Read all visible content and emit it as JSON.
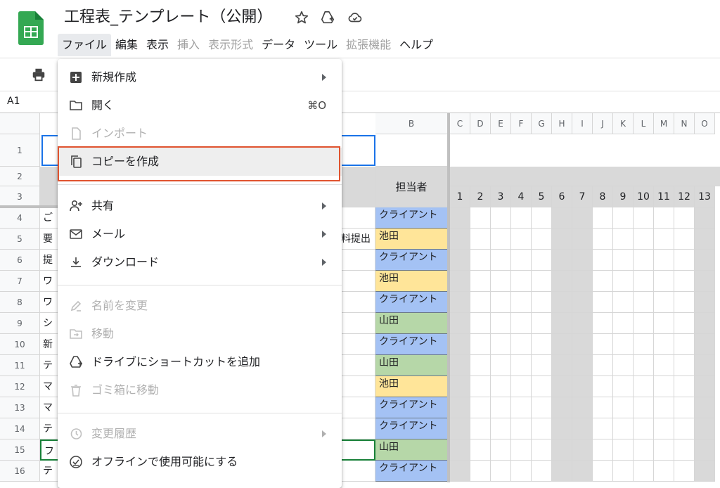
{
  "document": {
    "title": "工程表_テンプレート（公開）"
  },
  "menubar": {
    "items": [
      {
        "label": "ファイル",
        "state": "active"
      },
      {
        "label": "編集",
        "state": "enabled"
      },
      {
        "label": "表示",
        "state": "enabled"
      },
      {
        "label": "挿入",
        "state": "disabled"
      },
      {
        "label": "表示形式",
        "state": "disabled"
      },
      {
        "label": "データ",
        "state": "enabled"
      },
      {
        "label": "ツール",
        "state": "enabled"
      },
      {
        "label": "拡張機能",
        "state": "disabled"
      },
      {
        "label": "ヘルプ",
        "state": "enabled"
      }
    ]
  },
  "name_box": {
    "value": "A1"
  },
  "file_menu": {
    "items": [
      {
        "label": "新規作成",
        "icon": "new-sheet-icon",
        "submenu": true,
        "enabled": true
      },
      {
        "label": "開く",
        "icon": "folder-open-icon",
        "shortcut": "⌘O",
        "enabled": true
      },
      {
        "label": "インポート",
        "icon": "file-import-icon",
        "enabled": false
      },
      {
        "label": "コピーを作成",
        "icon": "copy-icon",
        "enabled": true,
        "highlighted": true
      },
      {
        "label": "共有",
        "icon": "person-add-icon",
        "submenu": true,
        "enabled": true
      },
      {
        "label": "メール",
        "icon": "mail-icon",
        "submenu": true,
        "enabled": true
      },
      {
        "label": "ダウンロード",
        "icon": "download-icon",
        "submenu": true,
        "enabled": true
      },
      {
        "label": "名前を変更",
        "icon": "rename-icon",
        "enabled": false
      },
      {
        "label": "移動",
        "icon": "move-folder-icon",
        "enabled": false
      },
      {
        "label": "ドライブにショートカットを追加",
        "icon": "drive-shortcut-icon",
        "enabled": true
      },
      {
        "label": "ゴミ箱に移動",
        "icon": "trash-icon",
        "enabled": false
      },
      {
        "label": "変更履歴",
        "icon": "history-icon",
        "submenu": true,
        "enabled": false
      },
      {
        "label": "オフラインで使用可能にする",
        "icon": "offline-icon",
        "enabled": true
      }
    ]
  },
  "grid": {
    "col_b_header": "B",
    "gantt_col_headers": [
      "C",
      "D",
      "E",
      "F",
      "G",
      "H",
      "I",
      "J",
      "K",
      "L",
      "M",
      "N",
      "O"
    ],
    "gantt_day_numbers": [
      "1",
      "2",
      "3",
      "4",
      "5",
      "6",
      "7",
      "8",
      "9",
      "10",
      "11",
      "12",
      "13"
    ],
    "row_numbers": [
      "1",
      "2",
      "3",
      "4",
      "5",
      "6",
      "7",
      "8",
      "9",
      "10",
      "11",
      "12",
      "13",
      "14",
      "15",
      "16"
    ],
    "assignee_header": "担当者",
    "task_stubs": [
      "ご",
      "要",
      "提",
      "ワ",
      "ワ",
      "シ",
      "新",
      "テ",
      "マ",
      "マ",
      "テ",
      "フ",
      "テ"
    ],
    "row5_partial_text": "料提出",
    "assignees": [
      "クライアント",
      "池田",
      "クライアント",
      "池田",
      "クライアント",
      "山田",
      "クライアント",
      "山田",
      "池田",
      "クライアント",
      "クライアント",
      "山田",
      "クライアント"
    ],
    "assignee_colors": {
      "クライアント": "#a4c2f4",
      "池田": "#ffe599",
      "山田": "#b6d7a8"
    }
  }
}
